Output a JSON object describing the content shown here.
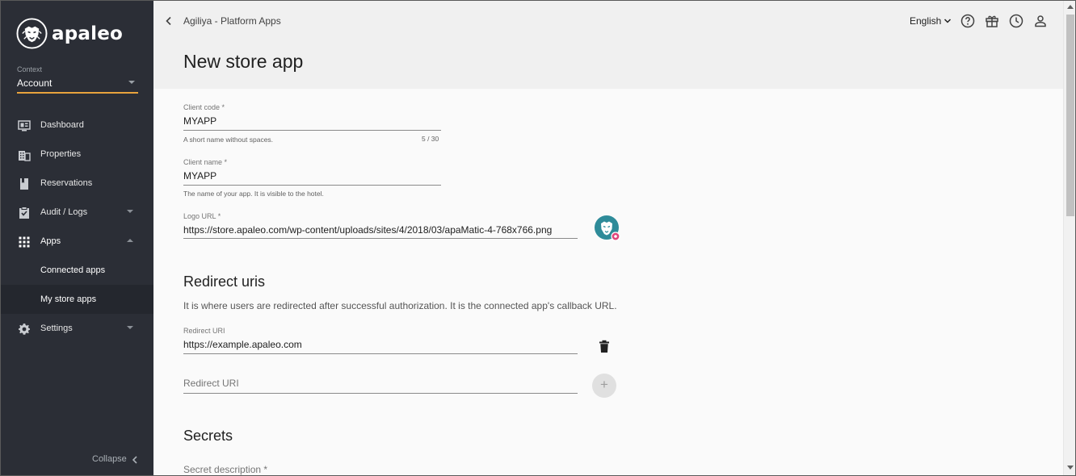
{
  "brand": {
    "name": "apaleo"
  },
  "context": {
    "label": "Context",
    "value": "Account"
  },
  "nav": {
    "items": [
      {
        "label": "Dashboard",
        "icon": "dashboard-icon"
      },
      {
        "label": "Properties",
        "icon": "building-icon"
      },
      {
        "label": "Reservations",
        "icon": "bookmark-icon"
      },
      {
        "label": "Audit / Logs",
        "icon": "audit-icon",
        "expand": "collapsed"
      },
      {
        "label": "Apps",
        "icon": "apps-grid-icon",
        "expand": "expanded"
      },
      {
        "label": "Settings",
        "icon": "gear-icon",
        "expand": "collapsed"
      }
    ],
    "apps_sub": [
      {
        "label": "Connected apps"
      },
      {
        "label": "My store apps",
        "active": true
      }
    ],
    "collapse_label": "Collapse"
  },
  "header": {
    "breadcrumb": "Agiliya - Platform Apps",
    "title": "New store app",
    "language": "English",
    "icons": [
      "help-icon",
      "gift-icon",
      "clock-icon",
      "user-icon"
    ]
  },
  "form": {
    "client_code": {
      "label": "Client code *",
      "value": "MYAPP",
      "hint": "A short name without spaces.",
      "counter": "5 / 30"
    },
    "client_name": {
      "label": "Client name *",
      "value": "MYAPP",
      "hint": "The name of your app. It is visible to the hotel."
    },
    "logo_url": {
      "label": "Logo URL *",
      "value": "https://store.apaleo.com/wp-content/uploads/sites/4/2018/03/apaMatic-4-768x766.png"
    },
    "redirect": {
      "title": "Redirect uris",
      "description": "It is where users are redirected after successful authorization. It is the connected app's callback URL.",
      "uri_label": "Redirect URI",
      "uri_value": "https://example.apaleo.com",
      "new_placeholder": "Redirect URI",
      "add_symbol": "+"
    },
    "secrets": {
      "title": "Secrets",
      "description_placeholder": "Secret description *"
    }
  },
  "colors": {
    "sidebar": "#2b2e36",
    "accent": "#e8a33d",
    "logo_teal": "#2e8b99",
    "logo_badge": "#e0457b"
  }
}
